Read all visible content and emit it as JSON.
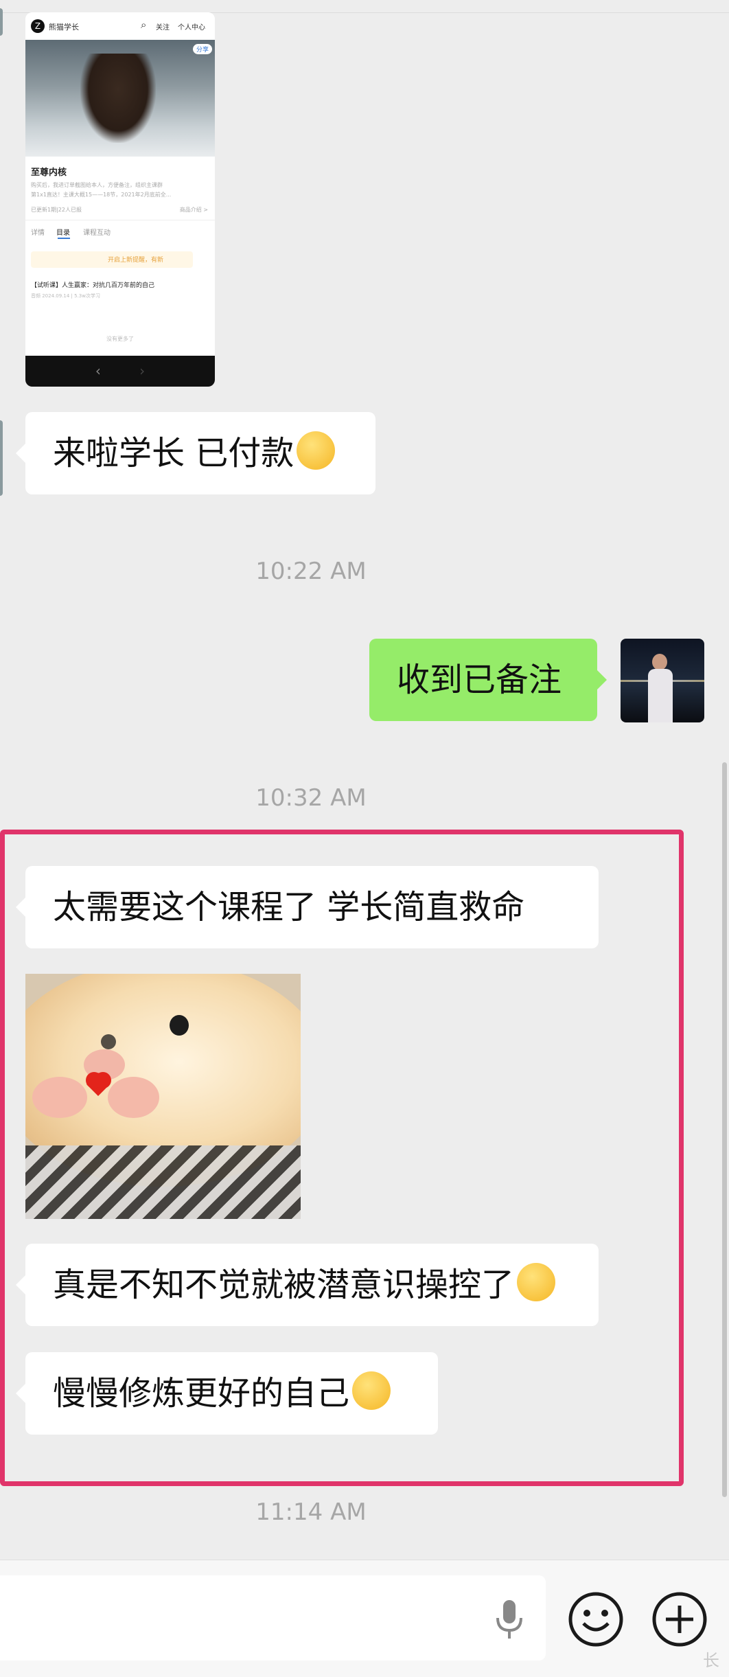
{
  "colors": {
    "background": "#ededed",
    "incoming_bubble": "#ffffff",
    "outgoing_bubble": "#95ec69",
    "highlight_box": "#e0346a",
    "timestamp": "#a6a6a6"
  },
  "screenshot_card": {
    "account_name": "熊猫学长",
    "follow": "关注",
    "profile": "个人中心",
    "share": "分享",
    "course_title": "至尊内核",
    "course_desc_1": "购买后，我进订单截图给本人，方便备注，组织主课群",
    "course_desc_2": "第1x1直达！主课大概15——18节，2021年2月底前全...",
    "updated": "已更新1期|22人已报",
    "product_intro": "商品介绍 >",
    "tabs": [
      "详情",
      "目录",
      "课程互动"
    ],
    "banner": "开启上新提醒，有新",
    "lesson_title": "【试听课】人生赢家：对抗几百万年前的自己",
    "lesson_meta": "音频  2024.09.14 | 5.3w次学习",
    "no_more": "没有更多了",
    "nav_back": "‹",
    "nav_forward": "›"
  },
  "messages": {
    "msg1": "来啦学长 已付款",
    "time1": "10:22 AM",
    "msg2": "收到已备注",
    "time2": "10:32 AM",
    "msg3": "太需要这个课程了 学长简直救命",
    "msg4": "真是不知不觉就被潜意识操控了",
    "msg5": "慢慢修炼更好的自己",
    "time3": "11:14 AM"
  },
  "icons": {
    "msg1_emoji": "thinking-monocle-emoji",
    "msg4_emoji": "tears-of-joy-emoji",
    "msg5_emoji": "shushing-emoji",
    "sticker": "hamster-heart-sticker",
    "voice": "microphone-icon",
    "emoji_button": "smiley-icon",
    "more_button": "plus-icon"
  },
  "watermark": "长"
}
